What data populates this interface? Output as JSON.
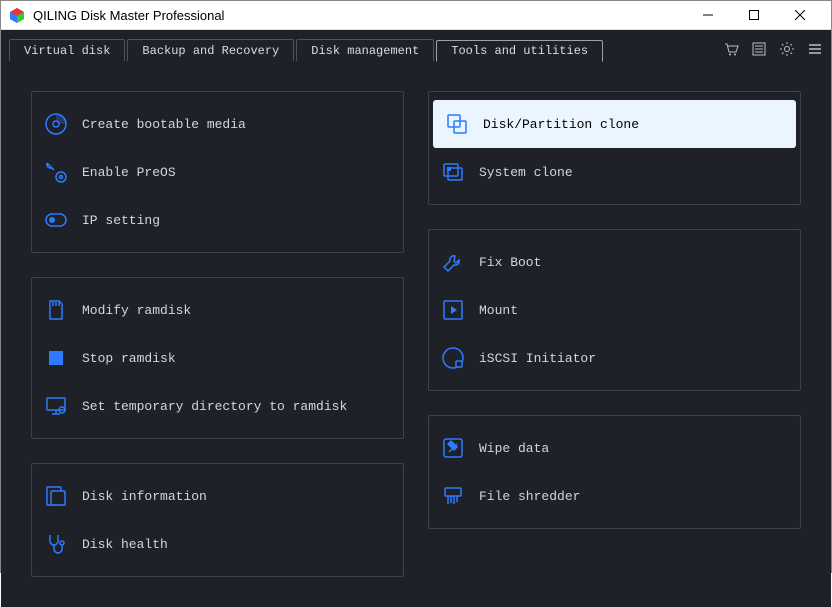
{
  "window": {
    "title": "QILING Disk Master Professional"
  },
  "tabs": {
    "virtual_disk": "Virtual disk",
    "backup_recovery": "Backup and Recovery",
    "disk_management": "Disk management",
    "tools_utilities": "Tools and utilities"
  },
  "left": {
    "group1": {
      "create_bootable": "Create bootable media",
      "enable_preos": "Enable PreOS",
      "ip_setting": "IP setting"
    },
    "group2": {
      "modify_ramdisk": "Modify ramdisk",
      "stop_ramdisk": "Stop ramdisk",
      "set_tempdir": "Set temporary directory to ramdisk"
    },
    "group3": {
      "disk_info": "Disk information",
      "disk_health": "Disk health"
    }
  },
  "right": {
    "group1": {
      "disk_partition_clone": "Disk/Partition clone",
      "system_clone": "System clone"
    },
    "group2": {
      "fix_boot": "Fix Boot",
      "mount": "Mount",
      "iscsi": "iSCSI Initiator"
    },
    "group3": {
      "wipe_data": "Wipe data",
      "file_shredder": "File shredder"
    }
  }
}
